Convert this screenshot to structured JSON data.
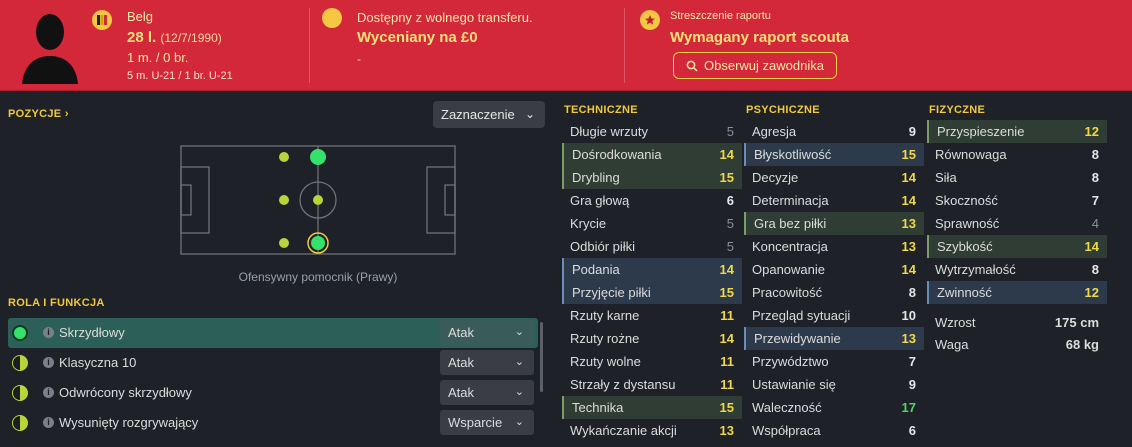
{
  "header": {
    "nationality": "Belg",
    "age": "28 l.",
    "dob": "(12/7/1990)",
    "apps": "1 m. / 0 br.",
    "u21": "5 m. U-21 / 1 br. U-21",
    "transfer_status": "Dostępny z wolnego transferu.",
    "valuation": "Wyceniany na £0",
    "valuation_sub": "-",
    "report_label": "Streszczenie raportu",
    "report_status": "Wymagany raport scouta",
    "watch_button": "Obserwuj zawodnika"
  },
  "positions": {
    "title": "POZYCJE",
    "chevron": "›",
    "dropdown": "Zaznaczenie",
    "position_label": "Ofensywny pomocnik (Prawy)"
  },
  "roles": {
    "title": "ROLA I FUNKCJA",
    "items": [
      {
        "name": "Skrzydłowy",
        "duty": "Atak",
        "rating": "full",
        "selected": true
      },
      {
        "name": "Klasyczna 10",
        "duty": "Atak",
        "rating": "half",
        "selected": false
      },
      {
        "name": "Odwrócony skrzydłowy",
        "duty": "Atak",
        "rating": "half",
        "selected": false
      },
      {
        "name": "Wysunięty rozgrywający",
        "duty": "Wsparcie",
        "rating": "half",
        "selected": false
      }
    ]
  },
  "attributes": {
    "technical": {
      "title": "TECHNICZNE",
      "items": [
        {
          "label": "Długie wrzuty",
          "value": "5",
          "hl": "",
          "vc": "d"
        },
        {
          "label": "Dośrodkowania",
          "value": "14",
          "hl": "hg",
          "vc": "y"
        },
        {
          "label": "Drybling",
          "value": "15",
          "hl": "hg",
          "vc": "y"
        },
        {
          "label": "Gra głową",
          "value": "6",
          "hl": "",
          "vc": ""
        },
        {
          "label": "Krycie",
          "value": "5",
          "hl": "",
          "vc": "d"
        },
        {
          "label": "Odbiór piłki",
          "value": "5",
          "hl": "",
          "vc": "d"
        },
        {
          "label": "Podania",
          "value": "14",
          "hl": "hb",
          "vc": "y"
        },
        {
          "label": "Przyjęcie piłki",
          "value": "15",
          "hl": "hb",
          "vc": "y"
        },
        {
          "label": "Rzuty karne",
          "value": "11",
          "hl": "",
          "vc": "y"
        },
        {
          "label": "Rzuty rożne",
          "value": "14",
          "hl": "",
          "vc": "y"
        },
        {
          "label": "Rzuty wolne",
          "value": "11",
          "hl": "",
          "vc": "y"
        },
        {
          "label": "Strzały z dystansu",
          "value": "11",
          "hl": "",
          "vc": "y"
        },
        {
          "label": "Technika",
          "value": "15",
          "hl": "hg",
          "vc": "y"
        },
        {
          "label": "Wykańczanie akcji",
          "value": "13",
          "hl": "",
          "vc": "y"
        }
      ]
    },
    "mental": {
      "title": "PSYCHICZNE",
      "items": [
        {
          "label": "Agresja",
          "value": "9",
          "hl": "",
          "vc": ""
        },
        {
          "label": "Błyskotliwość",
          "value": "15",
          "hl": "hb",
          "vc": "y"
        },
        {
          "label": "Decyzje",
          "value": "14",
          "hl": "",
          "vc": "y"
        },
        {
          "label": "Determinacja",
          "value": "14",
          "hl": "",
          "vc": "y"
        },
        {
          "label": "Gra bez piłki",
          "value": "13",
          "hl": "hg",
          "vc": "y"
        },
        {
          "label": "Koncentracja",
          "value": "13",
          "hl": "",
          "vc": "y"
        },
        {
          "label": "Opanowanie",
          "value": "14",
          "hl": "",
          "vc": "y"
        },
        {
          "label": "Pracowitość",
          "value": "8",
          "hl": "",
          "vc": ""
        },
        {
          "label": "Przegląd sytuacji",
          "value": "10",
          "hl": "",
          "vc": ""
        },
        {
          "label": "Przewidywanie",
          "value": "13",
          "hl": "hb",
          "vc": "y"
        },
        {
          "label": "Przywództwo",
          "value": "7",
          "hl": "",
          "vc": ""
        },
        {
          "label": "Ustawianie się",
          "value": "9",
          "hl": "",
          "vc": ""
        },
        {
          "label": "Waleczność",
          "value": "17",
          "hl": "",
          "vc": "g"
        },
        {
          "label": "Współpraca",
          "value": "6",
          "hl": "",
          "vc": ""
        }
      ]
    },
    "physical": {
      "title": "FIZYCZNE",
      "items": [
        {
          "label": "Przyspieszenie",
          "value": "12",
          "hl": "hg",
          "vc": "y"
        },
        {
          "label": "Równowaga",
          "value": "8",
          "hl": "",
          "vc": ""
        },
        {
          "label": "Siła",
          "value": "8",
          "hl": "",
          "vc": ""
        },
        {
          "label": "Skoczność",
          "value": "7",
          "hl": "",
          "vc": ""
        },
        {
          "label": "Sprawność",
          "value": "4",
          "hl": "",
          "vc": "d"
        },
        {
          "label": "Szybkość",
          "value": "14",
          "hl": "hg",
          "vc": "y"
        },
        {
          "label": "Wytrzymałość",
          "value": "8",
          "hl": "",
          "vc": ""
        },
        {
          "label": "Zwinność",
          "value": "12",
          "hl": "hb",
          "vc": "y"
        }
      ]
    },
    "height_label": "Wzrost",
    "height": "175 cm",
    "weight_label": "Waga",
    "weight": "68 kg"
  },
  "colors": {
    "header_bg": "#d3273a",
    "accent": "#f0c93c",
    "role_full": "#35e06b",
    "role_half": "#b8d43a"
  }
}
